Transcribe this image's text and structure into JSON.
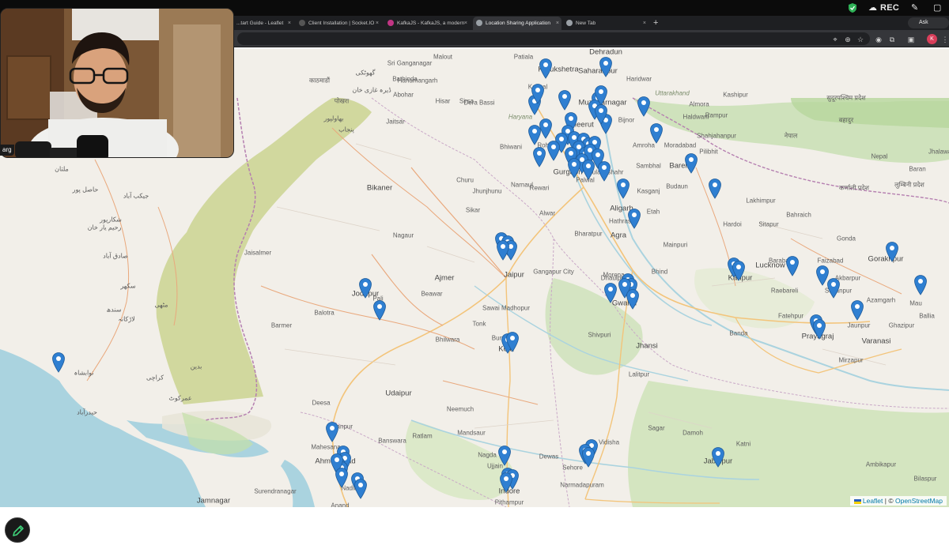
{
  "system": {
    "rec_label": "REC",
    "icons": [
      "shield-check-icon",
      "cloud-icon",
      "pen-icon",
      "window-icon"
    ]
  },
  "browser": {
    "tabs": [
      {
        "label": "...tart Guide - Leaflet",
        "active": false,
        "favicon_color": "#8bbf4a"
      },
      {
        "label": "Client Installation | Socket.IO",
        "active": false,
        "favicon_color": "#555555"
      },
      {
        "label": "KafkaJS - KafkaJS, a modern",
        "active": false,
        "favicon_color": "#c13584"
      },
      {
        "label": "Location Sharing Application",
        "active": true,
        "favicon_color": "#9aa0a6"
      },
      {
        "label": "New Tab",
        "active": false,
        "favicon_color": "#9aa0a6"
      }
    ],
    "new_tab_symbol": "+",
    "ask_gemini_label": "Ask Gemini",
    "profile_initial": "K"
  },
  "webcam": {
    "caption": "arg"
  },
  "map": {
    "places": [
      {
        "name": "Dehradun",
        "big": true
      },
      {
        "name": "Patiala"
      },
      {
        "name": "Kurukshetra",
        "big": true
      },
      {
        "name": "Saharanpur",
        "big": true
      },
      {
        "name": "Haridwar"
      },
      {
        "name": "Uttarakhand",
        "region": true
      },
      {
        "name": "Kaithal"
      },
      {
        "name": "Muzaffarnagar",
        "big": true
      },
      {
        "name": "Bijnor"
      },
      {
        "name": "Almora"
      },
      {
        "name": "Haryana",
        "region": true
      },
      {
        "name": "Meerut",
        "big": true
      },
      {
        "name": "Haldwani"
      },
      {
        "name": "Rohtak"
      },
      {
        "name": "Amroha"
      },
      {
        "name": "Moradabad"
      },
      {
        "name": "Bhiwani"
      },
      {
        "name": "Gurgaon",
        "big": true
      },
      {
        "name": "Bulandshahr"
      },
      {
        "name": "Sambhal"
      },
      {
        "name": "Bareilly",
        "big": true
      },
      {
        "name": "Pilibhit"
      },
      {
        "name": "Palwal"
      },
      {
        "name": "Rewari"
      },
      {
        "name": "Narnaul"
      },
      {
        "name": "Aligarh",
        "big": true
      },
      {
        "name": "Budaun"
      },
      {
        "name": "Lakhimpur"
      },
      {
        "name": "Bahraich"
      },
      {
        "name": "Kasganj"
      },
      {
        "name": "Etah"
      },
      {
        "name": "Alwar"
      },
      {
        "name": "Hathras"
      },
      {
        "name": "Hardoi"
      },
      {
        "name": "Sitapur"
      },
      {
        "name": "Agra",
        "big": true
      },
      {
        "name": "Bharatpur"
      },
      {
        "name": "Gonda"
      },
      {
        "name": "Barabanki"
      },
      {
        "name": "Faizabad"
      },
      {
        "name": "Gorakhpur",
        "big": true
      },
      {
        "name": "Mainpuri"
      },
      {
        "name": "Lucknow",
        "big": true
      },
      {
        "name": "Kanpur",
        "big": true
      },
      {
        "name": "Dhaulpur"
      },
      {
        "name": "Morena"
      },
      {
        "name": "Bhind"
      },
      {
        "name": "Raebareli"
      },
      {
        "name": "Sultanpur"
      },
      {
        "name": "Akbarpur"
      },
      {
        "name": "Azamgarh"
      },
      {
        "name": "Gwalior",
        "big": true
      },
      {
        "name": "Fatehpur"
      },
      {
        "name": "Jaunpur"
      },
      {
        "name": "Mau"
      },
      {
        "name": "Ghazipur"
      },
      {
        "name": "Ballia"
      },
      {
        "name": "Prayagraj",
        "big": true
      },
      {
        "name": "Varanasi",
        "big": true
      },
      {
        "name": "Banda"
      },
      {
        "name": "Shivpuri"
      },
      {
        "name": "Jhansi",
        "big": true
      },
      {
        "name": "Mirzapur"
      },
      {
        "name": "Lalitpur"
      },
      {
        "name": "Sagar"
      },
      {
        "name": "Damoh"
      },
      {
        "name": "Vidisha"
      },
      {
        "name": "Katni"
      },
      {
        "name": "Jabalpur",
        "big": true
      },
      {
        "name": "Sehore"
      },
      {
        "name": "Narmadapuram"
      },
      {
        "name": "Ambikapur"
      },
      {
        "name": "Bilaspur"
      },
      {
        "name": "Nagda"
      },
      {
        "name": "Ujjain"
      },
      {
        "name": "Indore",
        "big": true
      },
      {
        "name": "Dewas"
      },
      {
        "name": "Pithampur"
      },
      {
        "name": "Mandsaur"
      },
      {
        "name": "Neemuch"
      },
      {
        "name": "Ratlam"
      },
      {
        "name": "Banswara"
      },
      {
        "name": "Udaipur",
        "big": true
      },
      {
        "name": "Bhilwara"
      },
      {
        "name": "Bundi"
      },
      {
        "name": "Kota",
        "big": true
      },
      {
        "name": "Sawai Madhopur"
      },
      {
        "name": "Tonk"
      },
      {
        "name": "Gangapur City"
      },
      {
        "name": "Ajmer",
        "big": true
      },
      {
        "name": "Beawar"
      },
      {
        "name": "Jaipur",
        "big": true
      },
      {
        "name": "Nagaur"
      },
      {
        "name": "Sikar"
      },
      {
        "name": "Jhunjhunu"
      },
      {
        "name": "Churu"
      },
      {
        "name": "Bikaner",
        "big": true
      },
      {
        "name": "Jaisalmer"
      },
      {
        "name": "Jodhpur",
        "big": true
      },
      {
        "name": "Balotra"
      },
      {
        "name": "Barmer"
      },
      {
        "name": "Pali"
      },
      {
        "name": "Deesa"
      },
      {
        "name": "Palanpur"
      },
      {
        "name": "Mahesana"
      },
      {
        "name": "Ahmedabad",
        "big": true
      },
      {
        "name": "Nadiad"
      },
      {
        "name": "Anand"
      },
      {
        "name": "Surendranagar"
      },
      {
        "name": "Jamnagar",
        "big": true
      },
      {
        "name": "Sri Ganganagar"
      },
      {
        "name": "Hanumangarh"
      },
      {
        "name": "Sirsa"
      },
      {
        "name": "Jaitsar"
      },
      {
        "name": "Hisar"
      },
      {
        "name": "Malout"
      },
      {
        "name": "Bathinda"
      },
      {
        "name": "Abohar"
      },
      {
        "name": "Dera Bassi"
      },
      {
        "name": "Shahjahanpur"
      },
      {
        "name": "Kashipur"
      },
      {
        "name": "Rampur"
      },
      {
        "name": "Baran"
      },
      {
        "name": "Jhalawar"
      },
      {
        "name": "Nepal"
      },
      {
        "name": "बहादुर"
      },
      {
        "name": "नेपाल"
      },
      {
        "name": "कर्णाली प्रदेश"
      },
      {
        "name": "सुदूरपश्चिम प्रदेश"
      },
      {
        "name": "लुम्बिनी प्रदेश"
      },
      {
        "name": "पोखरा"
      },
      {
        "name": "काठमाडौं"
      },
      {
        "name": "بهاولپور"
      },
      {
        "name": "ملتان"
      },
      {
        "name": "حاصل پور"
      },
      {
        "name": "رحیم یار خان"
      },
      {
        "name": "صادق آباد"
      },
      {
        "name": "سکھر"
      },
      {
        "name": "لاڑکانہ"
      },
      {
        "name": "نوابشاہ"
      },
      {
        "name": "حیدرآباد"
      },
      {
        "name": "کراچی"
      },
      {
        "name": "بدین"
      },
      {
        "name": "عمرکوٹ"
      },
      {
        "name": "مٹھی"
      },
      {
        "name": "سندھ"
      },
      {
        "name": "شکارپور"
      },
      {
        "name": "جیکب آباد"
      },
      {
        "name": "گھوٹکی"
      },
      {
        "name": "پنجاب"
      },
      {
        "name": "ڈیرہ غازی خان"
      },
      {
        "name": "وہاڑی"
      }
    ],
    "markers": [
      "marker",
      "marker",
      "marker",
      "marker",
      "marker",
      "marker",
      "marker",
      "marker",
      "marker",
      "marker",
      "marker",
      "marker",
      "marker",
      "marker",
      "marker",
      "marker",
      "marker",
      "marker",
      "marker",
      "marker",
      "marker",
      "marker",
      "marker",
      "marker",
      "marker",
      "marker",
      "marker",
      "marker",
      "marker",
      "marker",
      "marker",
      "marker",
      "marker",
      "marker",
      "marker",
      "marker",
      "marker",
      "marker",
      "marker",
      "marker",
      "marker",
      "marker",
      "marker",
      "marker",
      "marker",
      "marker",
      "marker",
      "marker",
      "marker",
      "marker",
      "marker",
      "marker",
      "marker",
      "marker",
      "marker",
      "marker",
      "marker",
      "marker",
      "marker",
      "marker",
      "marker",
      "marker",
      "marker",
      "marker",
      "marker",
      "marker",
      "marker",
      "marker",
      "marker",
      "marker",
      "marker",
      "marker",
      "marker",
      "marker",
      "marker",
      "marker",
      "marker",
      "marker"
    ],
    "marker_color": "#2f7fd1",
    "attribution": {
      "leaflet": "Leaflet",
      "separator": "| ©",
      "osm": "OpenStreetMap"
    }
  },
  "tool": {
    "pencil_icon": "pencil-icon"
  }
}
